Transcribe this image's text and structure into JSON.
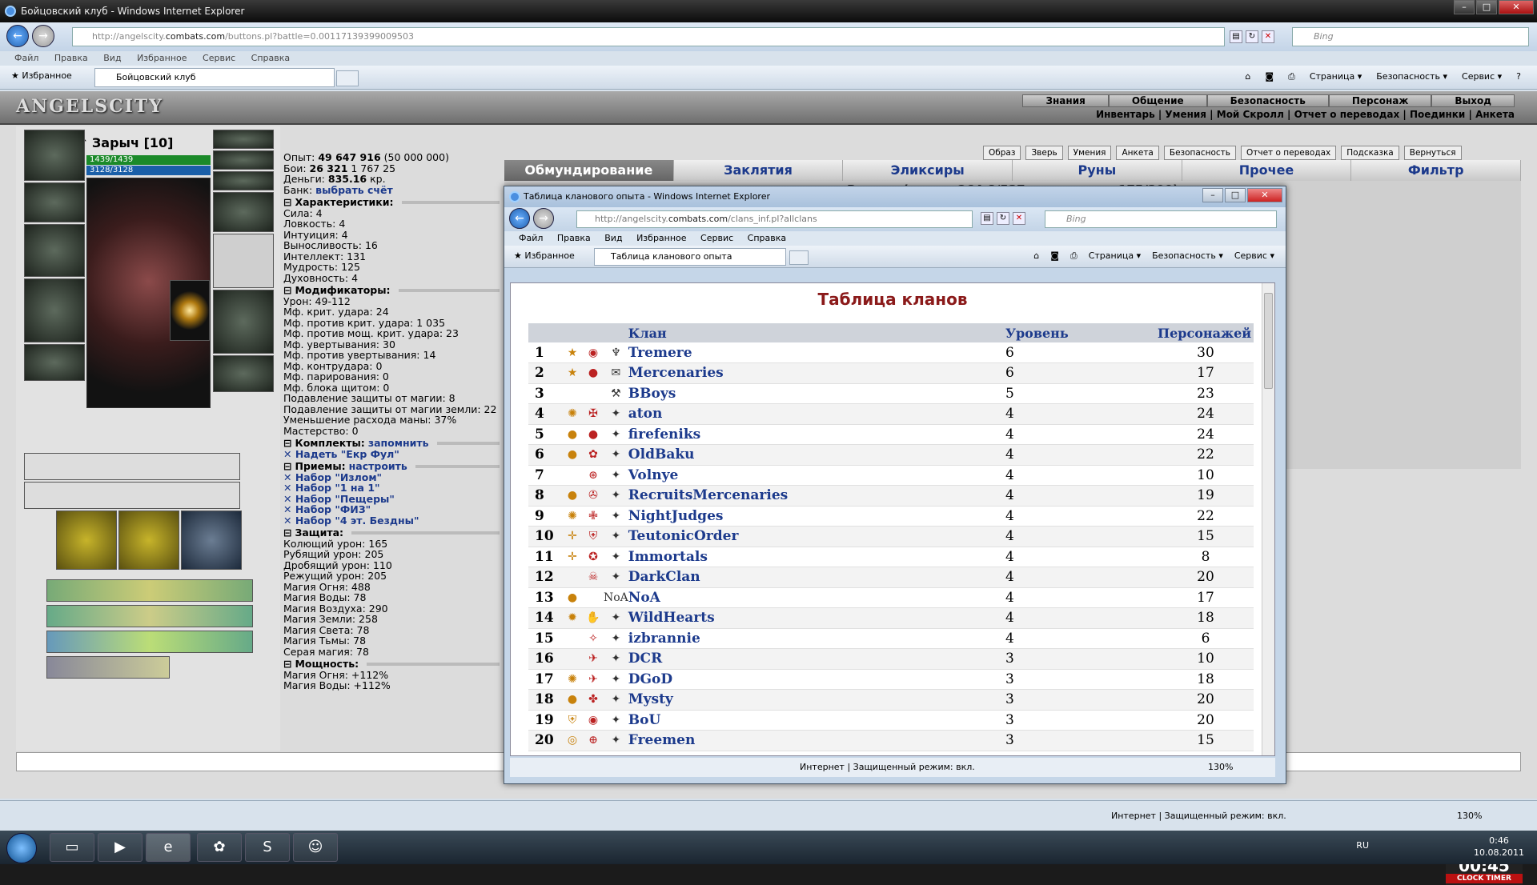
{
  "main_window": {
    "title": "Бойцовский клуб - Windows Internet Explorer",
    "controls": [
      "–",
      "□",
      "✕"
    ],
    "url_prefix": "http://angelscity.",
    "url_domain": "combats.com",
    "url_rest": "/buttons.pl?battle=0.00117139399009503",
    "search_placeholder": "Bing",
    "menu": [
      "Файл",
      "Правка",
      "Вид",
      "Избранное",
      "Сервис",
      "Справка"
    ],
    "favorites_label": "Избранное",
    "tab_title": "Бойцовский клуб",
    "commands": [
      "Страница ▾",
      "Безопасность ▾",
      "Сервис ▾",
      "?"
    ],
    "status_text": "Интернет | Защищенный режим: вкл.",
    "zoom": "130%"
  },
  "game": {
    "logo": "ANGELSCITY",
    "top_nav": [
      "Знания",
      "Общение",
      "Безопасность",
      "Персонаж",
      "Выход"
    ],
    "sub_nav": "Инвентарь | Умения | Мой Скролл | Отчет о переводах | Поединки | Анкета",
    "char_name": "Зарыч [10]",
    "hp": "1439/1439",
    "mana": "3128/3128",
    "info": [
      {
        "label": "Опыт:",
        "value": "49 647 916",
        "extra": "(50 000 000)"
      },
      {
        "label": "Бои:",
        "value": "26 321",
        "extra": "1 767   25"
      },
      {
        "label": "Деньги:",
        "value": "835.16",
        "extra": "кр."
      },
      {
        "label": "Банк:",
        "value": "выбрать счёт",
        "extra": ""
      }
    ],
    "characteristics_header": "Характеристики:",
    "characteristics": [
      "Сила: 4",
      "Ловкость: 4",
      "Интуиция: 4",
      "Выносливость: 16",
      "Интеллект: 131",
      "Мудрость: 125",
      "Духовность: 4"
    ],
    "modifiers_header": "Модификаторы:",
    "modifiers": [
      "Урон: 49-112",
      "Мф. крит. удара: 24",
      "Мф. против крит. удара: 1 035",
      "Мф. против мощ. крит. удара: 23",
      "Мф. увертывания: 30",
      "Мф. против увертывания: 14",
      "Мф. контрудара: 0",
      "Мф. парирования: 0",
      "Мф. блока щитом: 0",
      "Подавление защиты от магии: 8",
      "Подавление защиты от магии земли: 22",
      "Уменьшение расхода маны: 37%",
      "Мастерство: 0"
    ],
    "sets_header": "Комплекты:",
    "sets_link": "запомнить",
    "sets": [
      "Надеть \"Екр Фул\""
    ],
    "tricks_header": "Приемы:",
    "tricks_link": "настроить",
    "tricks": [
      "Набор \"Излом\"",
      "Набор \"1 на 1\"",
      "Набор \"Пещеры\"",
      "Набор \"ФИЗ\"",
      "Набор \"4 эт. Бездны\""
    ],
    "defense_header": "Защита:",
    "defense": [
      "Колющий урон: 165",
      "Рубящий урон: 205",
      "Дробящий урон: 110",
      "Режущий урон: 205",
      "Магия Огня: 488",
      "Магия Воды: 78",
      "Магия Воздуха: 290",
      "Магия Земли: 258",
      "Магия Света: 78",
      "Магия Тьмы: 78",
      "Серая магия: 78"
    ],
    "power_header": "Мощность:",
    "power": [
      "Магия Огня: +112%",
      "Магия Воды: +112%"
    ],
    "small_buttons": [
      "Образ",
      "Зверь",
      "Умения",
      "Анкета",
      "Безопасность",
      "Отчет о переводах",
      "Подсказка",
      "Вернуться"
    ],
    "bag_tabs": [
      "Обмундирование",
      "Заклятия",
      "Эликсиры",
      "Руны",
      "Прочее",
      "Фильтр"
    ],
    "backpack": "Рюкзак (масса: 264.8/537, предметов: 175/300)",
    "timer": "00:45",
    "timer_label": "CLOCK TIMER"
  },
  "popup": {
    "title": "Таблица кланового опыта - Windows Internet Explorer",
    "url_prefix": "http://angelscity.",
    "url_domain": "combats.com",
    "url_rest": "/clans_inf.pl?allclans",
    "search_placeholder": "Bing",
    "menu": [
      "Файл",
      "Правка",
      "Вид",
      "Избранное",
      "Сервис",
      "Справка"
    ],
    "favorites_label": "Избранное",
    "tab_title": "Таблица кланового опыта",
    "commands": [
      "Страница ▾",
      "Безопасность ▾",
      "Сервис ▾"
    ],
    "heading": "Таблица кланов",
    "columns": {
      "clan": "Клан",
      "level": "Уровень",
      "members": "Персонажей"
    },
    "status_text": "Интернет | Защищенный режим: вкл.",
    "zoom": "130%",
    "rows": [
      {
        "rank": "1",
        "name": "Tremere",
        "level": "6",
        "members": "30"
      },
      {
        "rank": "2",
        "name": "Mercenaries",
        "level": "6",
        "members": "17"
      },
      {
        "rank": "3",
        "name": "BBoys",
        "level": "5",
        "members": "23"
      },
      {
        "rank": "4",
        "name": "aton",
        "level": "4",
        "members": "24"
      },
      {
        "rank": "5",
        "name": "firefeniks",
        "level": "4",
        "members": "24"
      },
      {
        "rank": "6",
        "name": "OldBaku",
        "level": "4",
        "members": "22"
      },
      {
        "rank": "7",
        "name": "Volnye",
        "level": "4",
        "members": "10"
      },
      {
        "rank": "8",
        "name": "RecruitsMercenaries",
        "level": "4",
        "members": "19"
      },
      {
        "rank": "9",
        "name": "NightJudges",
        "level": "4",
        "members": "22"
      },
      {
        "rank": "10",
        "name": "TeutonicOrder",
        "level": "4",
        "members": "15"
      },
      {
        "rank": "11",
        "name": "Immortals",
        "level": "4",
        "members": "8"
      },
      {
        "rank": "12",
        "name": "DarkClan",
        "level": "4",
        "members": "20"
      },
      {
        "rank": "13",
        "name": "NoA",
        "level": "4",
        "members": "17"
      },
      {
        "rank": "14",
        "name": "WildHearts",
        "level": "4",
        "members": "18"
      },
      {
        "rank": "15",
        "name": "izbrannie",
        "level": "4",
        "members": "6"
      },
      {
        "rank": "16",
        "name": "DCR",
        "level": "3",
        "members": "10"
      },
      {
        "rank": "17",
        "name": "DGoD",
        "level": "3",
        "members": "18"
      },
      {
        "rank": "18",
        "name": "Mysty",
        "level": "3",
        "members": "20"
      },
      {
        "rank": "19",
        "name": "BoU",
        "level": "3",
        "members": "20"
      },
      {
        "rank": "20",
        "name": "Freemen",
        "level": "3",
        "members": "15"
      }
    ]
  },
  "taskbar": {
    "lang": "RU",
    "time": "0:46",
    "date": "10.08.2011"
  }
}
